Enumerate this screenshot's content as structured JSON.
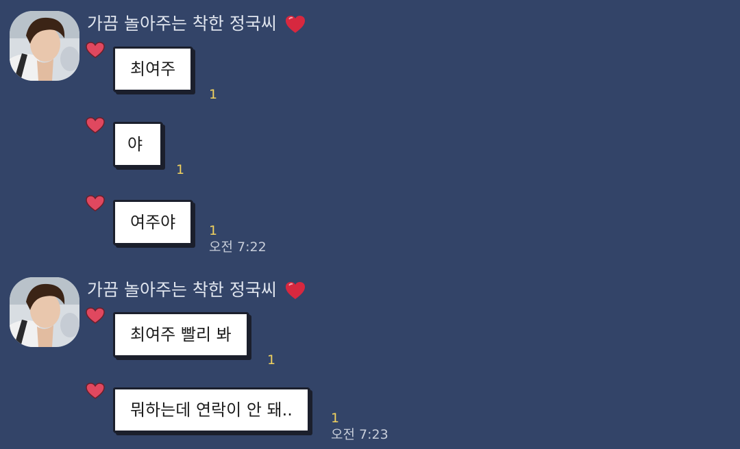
{
  "chat": {
    "colors": {
      "background": "#334468",
      "bubble": "#ffffff",
      "bubble_border": "#1b1f2c",
      "unread": "#f3d35e",
      "sender_name": "#e1e6ef",
      "time": "#c8ceda",
      "heart": "#e0485f"
    },
    "groups": [
      {
        "sender": "가끔 놀아주는 착한 정국씨",
        "sender_icon": "red-heart-icon",
        "avatar": "profile-photo",
        "messages": [
          {
            "text": "최여주",
            "unread": "1"
          },
          {
            "text": "야",
            "unread": "1"
          },
          {
            "text": "여주야",
            "unread": "1",
            "time": "오전 7:22"
          }
        ]
      },
      {
        "sender": "가끔 놀아주는 착한 정국씨",
        "sender_icon": "red-heart-icon",
        "avatar": "profile-photo",
        "messages": [
          {
            "text": "최여주 빨리 봐",
            "unread": "1"
          },
          {
            "text": "뭐하는데 연락이 안 돼..",
            "unread": "1",
            "time": "오전 7:23"
          }
        ]
      }
    ]
  }
}
